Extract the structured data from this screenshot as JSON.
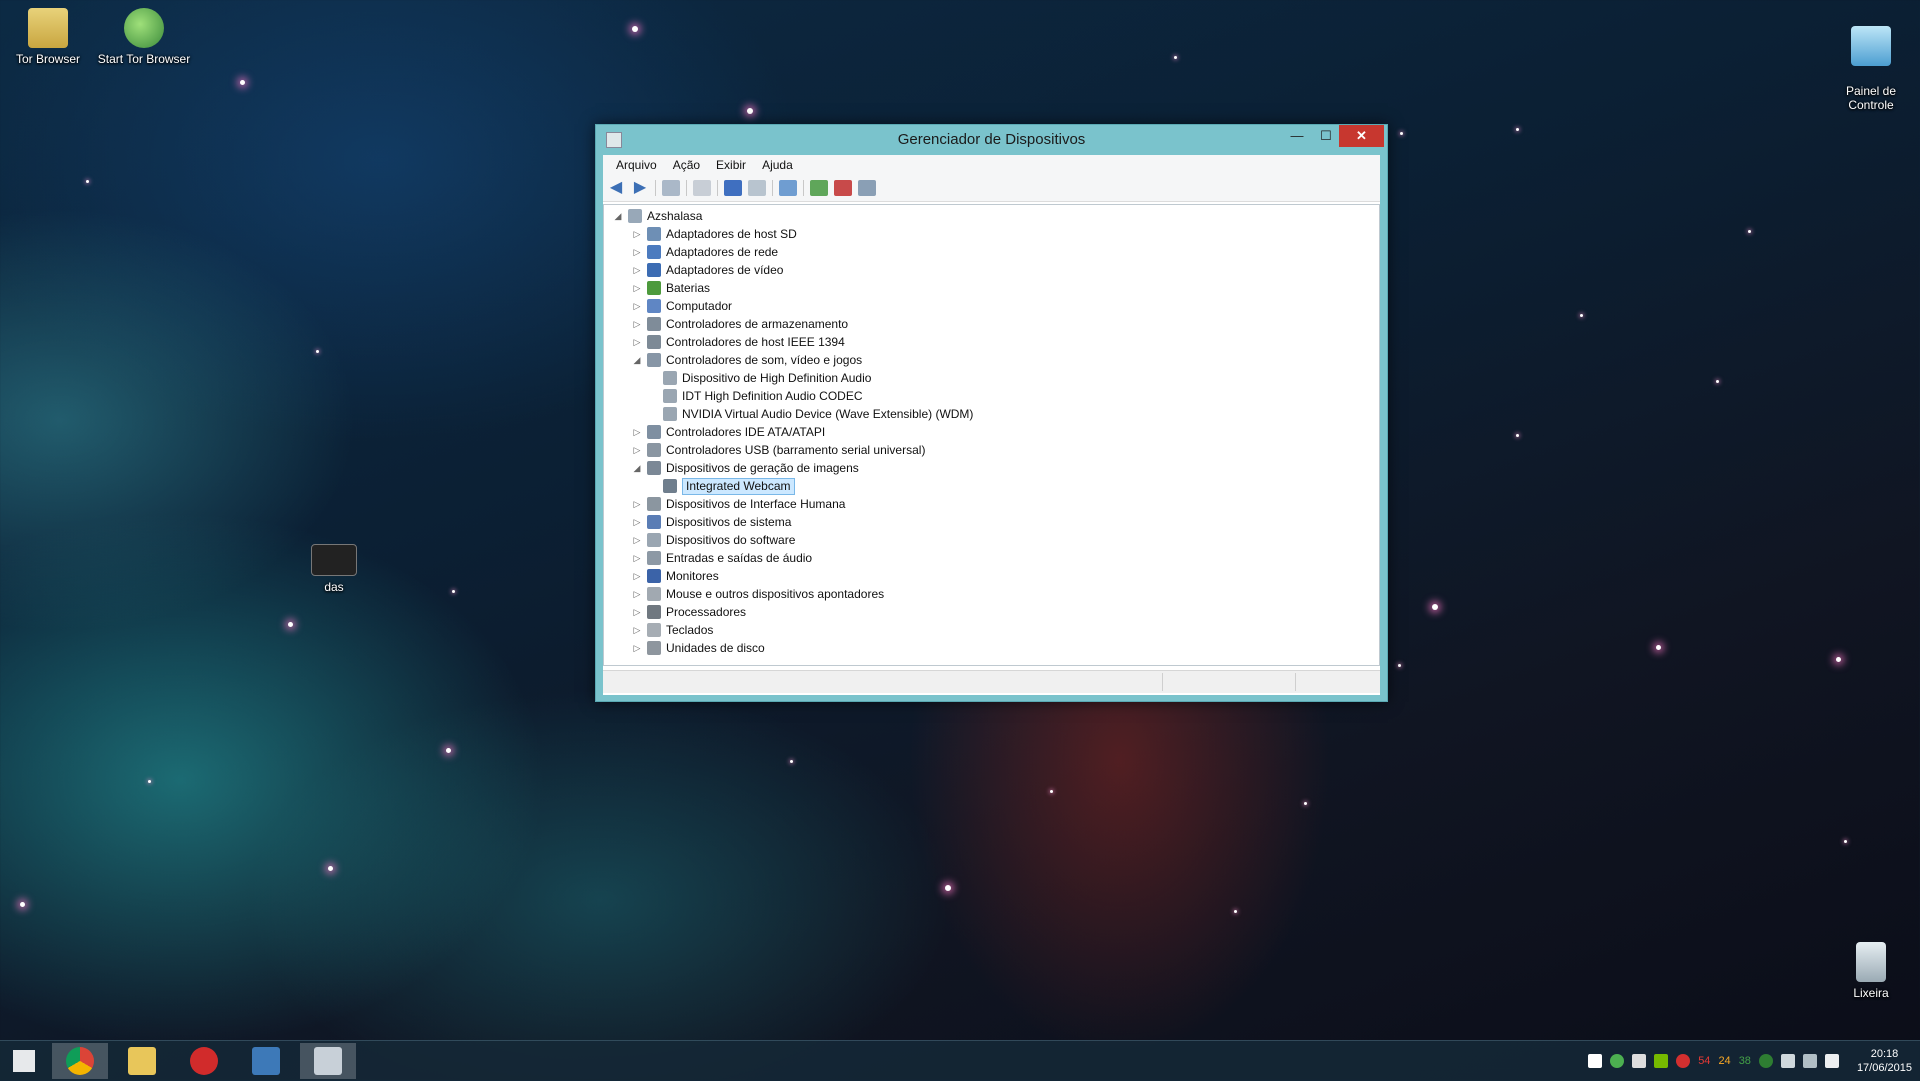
{
  "desktop": {
    "icons": [
      {
        "label": "Tor Browser"
      },
      {
        "label": "Start Tor Browser"
      },
      {
        "label": "Painel de\nControle"
      },
      {
        "label": "das"
      },
      {
        "label": "Lixeira"
      }
    ]
  },
  "window": {
    "title": "Gerenciador de Dispositivos",
    "controls": {
      "minimize": "—",
      "maximize": "☐",
      "close": "✕"
    },
    "menu": [
      "Arquivo",
      "Ação",
      "Exibir",
      "Ajuda"
    ],
    "tree": {
      "root": "Azshalasa",
      "items": [
        {
          "label": "Adaptadores de host SD",
          "expanded": false,
          "depth": 1
        },
        {
          "label": "Adaptadores de rede",
          "expanded": false,
          "depth": 1
        },
        {
          "label": "Adaptadores de vídeo",
          "expanded": false,
          "depth": 1
        },
        {
          "label": "Baterias",
          "expanded": false,
          "depth": 1
        },
        {
          "label": "Computador",
          "expanded": false,
          "depth": 1
        },
        {
          "label": "Controladores de armazenamento",
          "expanded": false,
          "depth": 1
        },
        {
          "label": "Controladores de host IEEE 1394",
          "expanded": false,
          "depth": 1
        },
        {
          "label": "Controladores de som, vídeo e jogos",
          "expanded": true,
          "depth": 1
        },
        {
          "label": "Dispositivo de High Definition Audio",
          "depth": 2
        },
        {
          "label": "IDT High Definition Audio CODEC",
          "depth": 2
        },
        {
          "label": "NVIDIA Virtual Audio Device (Wave Extensible) (WDM)",
          "depth": 2
        },
        {
          "label": "Controladores IDE ATA/ATAPI",
          "expanded": false,
          "depth": 1
        },
        {
          "label": "Controladores USB (barramento serial universal)",
          "expanded": false,
          "depth": 1
        },
        {
          "label": "Dispositivos de geração de imagens",
          "expanded": true,
          "depth": 1
        },
        {
          "label": "Integrated Webcam",
          "depth": 2,
          "selected": true
        },
        {
          "label": "Dispositivos de Interface Humana",
          "expanded": false,
          "depth": 1
        },
        {
          "label": "Dispositivos de sistema",
          "expanded": false,
          "depth": 1
        },
        {
          "label": "Dispositivos do software",
          "expanded": false,
          "depth": 1
        },
        {
          "label": "Entradas e saídas de áudio",
          "expanded": false,
          "depth": 1
        },
        {
          "label": "Monitores",
          "expanded": false,
          "depth": 1
        },
        {
          "label": "Mouse e outros dispositivos apontadores",
          "expanded": false,
          "depth": 1
        },
        {
          "label": "Processadores",
          "expanded": false,
          "depth": 1
        },
        {
          "label": "Teclados",
          "expanded": false,
          "depth": 1
        },
        {
          "label": "Unidades de disco",
          "expanded": false,
          "depth": 1
        }
      ]
    }
  },
  "taskbar": {
    "apps": [
      "start",
      "chrome",
      "file-explorer",
      "t-app",
      "visual-studio",
      "device-manager"
    ],
    "tray": {
      "numbers": [
        "54",
        "24",
        "38"
      ]
    },
    "clock": {
      "time": "20:18",
      "date": "17/06/2015"
    }
  }
}
